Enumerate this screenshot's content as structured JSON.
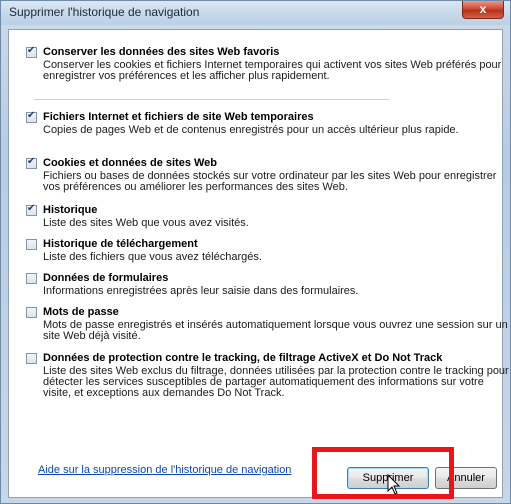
{
  "window": {
    "title": "Supprimer l'historique de navigation",
    "close_label": "x"
  },
  "options": [
    {
      "title": "Conserver les données des sites Web favoris",
      "desc": "Conserver les cookies et fichiers Internet temporaires qui activent vos sites Web préférés pour enregistrer vos préférences et les afficher plus rapidement.",
      "checked": true
    },
    {
      "title": "Fichiers Internet et fichiers de site Web temporaires",
      "desc": "Copies de pages Web et de contenus enregistrés pour un accès ultérieur plus rapide.",
      "checked": true
    },
    {
      "title": "Cookies et données de sites Web",
      "desc": "Fichiers ou bases de données stockés sur votre ordinateur par les sites Web pour enregistrer vos préférences ou améliorer les performances des sites Web.",
      "checked": true
    },
    {
      "title": "Historique",
      "desc": "Liste des sites Web que vous avez visités.",
      "checked": true
    },
    {
      "title": "Historique de téléchargement",
      "desc": "Liste des fichiers que vous avez téléchargés.",
      "checked": false
    },
    {
      "title": "Données de formulaires",
      "desc": "Informations enregistrées après leur saisie dans des formulaires.",
      "checked": false
    },
    {
      "title": "Mots de passe",
      "desc": "Mots de passe enregistrés et insérés automatiquement lorsque vous ouvrez une session sur un site Web déjà visité.",
      "checked": false
    },
    {
      "title": "Données de protection contre le tracking, de filtrage ActiveX et Do Not Track",
      "desc": "Liste des sites Web exclus du filtrage, données utilisées par la protection contre le tracking pour détecter les services susceptibles de partager automatiquement des informations sur votre visite, et exceptions aux demandes Do Not Track.",
      "checked": false
    }
  ],
  "footer": {
    "help_link": "Aide sur la suppression de l'historique de navigation",
    "delete_button": "Supprimer",
    "cancel_button": "Annuler"
  },
  "colors": {
    "highlight": "#e8161b",
    "link": "#0b49b3"
  }
}
